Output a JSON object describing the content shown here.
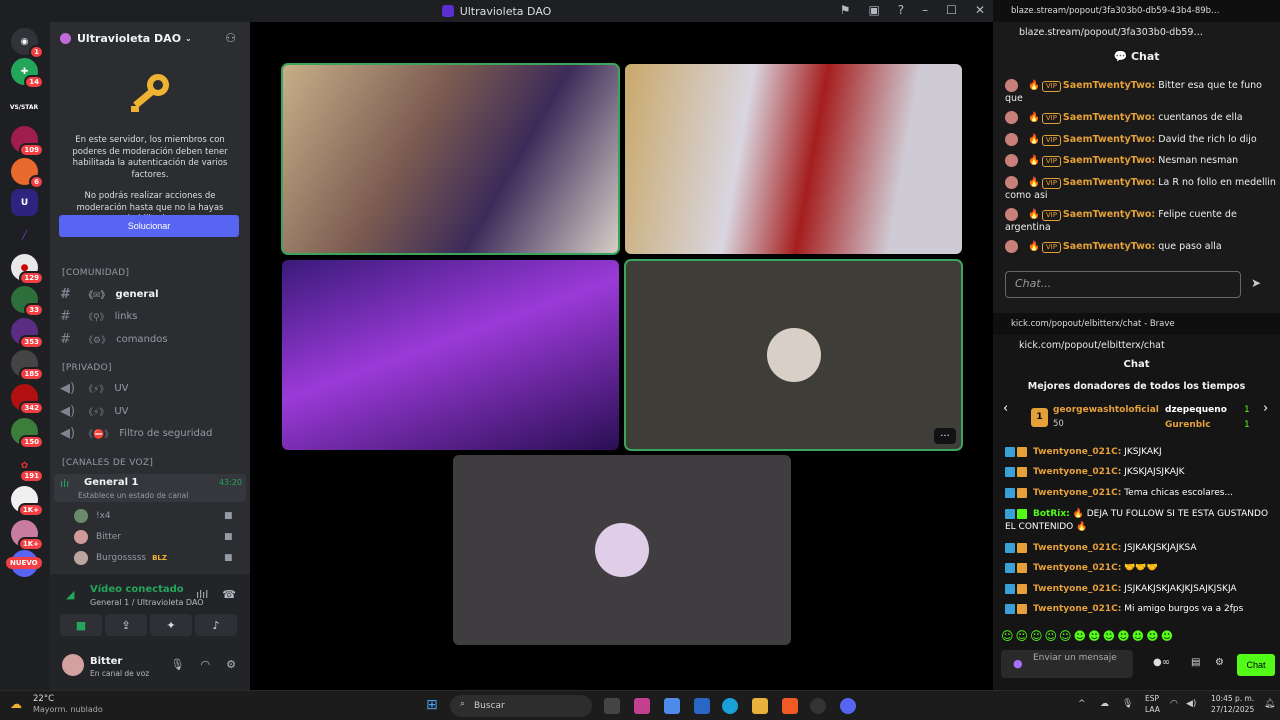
{
  "discord": {
    "window_title": "Ultravioleta DAO",
    "server_name": "Ultravioleta DAO",
    "rail_badges": [
      "1",
      "14",
      "109",
      "6",
      "129",
      "33",
      "353",
      "185",
      "342",
      "150",
      "191",
      "1K+",
      "1K+"
    ],
    "nuevo_label": "NUEVO",
    "rail_label_vstar": "VS/STAR",
    "notice_1": "En este servidor, los miembros con poderes de moderación deben tener habilitada la autenticación de varios factores.",
    "notice_2": "No podrás realizar acciones de moderación hasta que no la hayas habilitado.",
    "solve_button": "Solucionar",
    "categories": {
      "comunidad": "COMUNIDAD",
      "privado": "PRIVADO",
      "voz": "CANALES DE VOZ"
    },
    "text_channels": [
      {
        "name": "general",
        "active": true
      },
      {
        "name": "links",
        "active": false
      },
      {
        "name": "comandos",
        "active": false
      }
    ],
    "private_channels": [
      "UV",
      "UV",
      "Filtro de seguridad"
    ],
    "voice_channel": {
      "name": "General 1",
      "time": "43:20",
      "status": "Establece un estado de canal"
    },
    "voice_users": [
      "!x4",
      "Bitter",
      "Burgosssss"
    ],
    "voice_user_tag": "BLZ",
    "voice_panel": {
      "connected": "Vídeo conectado",
      "location": "General 1 / Ultravioleta DAO"
    },
    "user": {
      "name": "Bitter",
      "status": "En canal de voz"
    }
  },
  "stage": {
    "participants": 5,
    "more_label": "···"
  },
  "blaze": {
    "tab_title": "blaze.stream/popout/3fa303b0-db59-43b4-89b…",
    "url": "blaze.stream/popout/3fa303b0-db59…",
    "chat_title": "Chat",
    "vip_label": "VIP",
    "messages": [
      {
        "user": "SaemTwentyTwo:",
        "text": "Bitter esa que te funo que"
      },
      {
        "user": "SaemTwentyTwo:",
        "text": "cuentanos de ella"
      },
      {
        "user": "SaemTwentyTwo:",
        "text": "David the rich lo dijo"
      },
      {
        "user": "SaemTwentyTwo:",
        "text": "Nesman nesman"
      },
      {
        "user": "SaemTwentyTwo:",
        "text": "La R no follo en medellin como asi"
      },
      {
        "user": "SaemTwentyTwo:",
        "text": "Felipe cuente de argentina"
      },
      {
        "user": "SaemTwentyTwo:",
        "text": "que paso alla"
      }
    ],
    "input_placeholder": "Chat..."
  },
  "kick": {
    "tab_title": "kick.com/popout/elbitterx/chat - Brave",
    "url": "kick.com/popout/elbitterx/chat",
    "chat_title": "Chat",
    "donors_title": "Mejores donadores de todos los tiempos",
    "donors": [
      {
        "rank": "1",
        "name": "georgewashtoloficial",
        "amount": "50"
      },
      {
        "name": "dzepequeno",
        "amount": "1"
      },
      {
        "name": "Gurenblc",
        "amount": "1"
      }
    ],
    "messages": [
      {
        "user": "Twentyone_021C:",
        "text": "JKSJKAKJ"
      },
      {
        "user": "Twentyone_021C:",
        "text": "JKSKJAJSJKAJK"
      },
      {
        "user": "Twentyone_021C:",
        "text": "Tema chicas escolares..."
      },
      {
        "user": "BotRix:",
        "text": "DEJA TU FOLLOW SI TE ESTA GUSTANDO EL CONTENIDO",
        "bot": true
      },
      {
        "user": "Twentyone_021C:",
        "text": "JSJKAKJSKJAJKSA"
      },
      {
        "user": "Twentyone_021C:",
        "text": ""
      },
      {
        "user": "Twentyone_021C:",
        "text": "JSJKAKJSKJAKJKJSAJKJSKJA"
      },
      {
        "user": "Twentyone_021C:",
        "text": "Mi amigo burgos va a 2fps"
      }
    ],
    "input_placeholder": "Enviar un mensaje",
    "chat_button": "Chat"
  },
  "taskbar": {
    "weather_temp": "22°C",
    "weather_desc": "Mayorm. nublado",
    "search": "Buscar",
    "lang": "ESP",
    "lang2": "LAA",
    "time": "10:45 p. m.",
    "date": "27/12/2025"
  }
}
